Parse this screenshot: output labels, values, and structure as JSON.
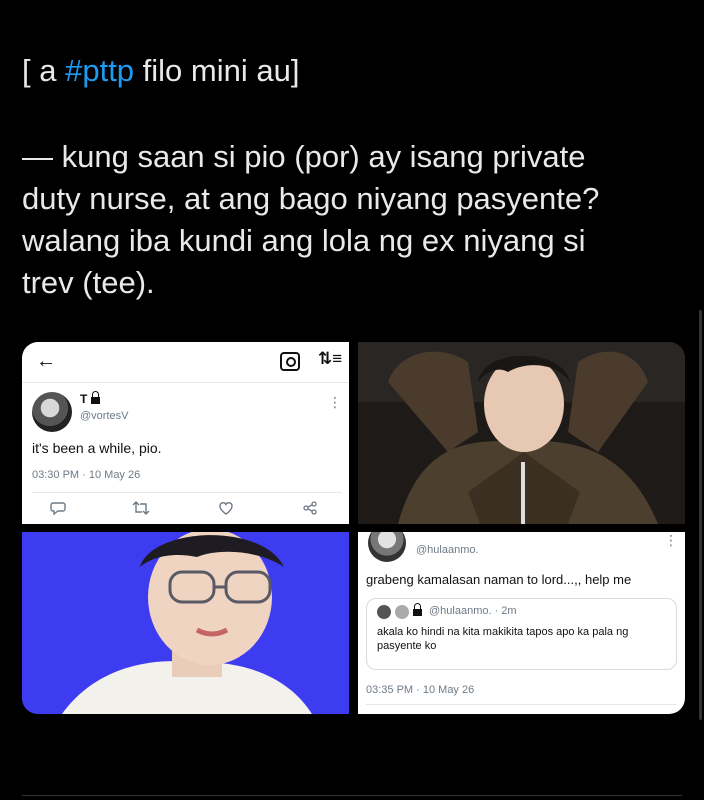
{
  "tweet": {
    "line_open": "[ a ",
    "hashtag": "#pttp",
    "line_close": " filo mini au]",
    "body_lines": [
      "— kung saan si pio (por) ay isang private",
      "duty nurse, at ang bago niyang pasyente?",
      "walang iba kundi ang lola ng ex niyang si",
      "trev (tee)."
    ]
  },
  "screenshot_1": {
    "back_icon": "arrow-left-icon",
    "camera_icon": "camera-icon",
    "sort_icon": "sort-icon",
    "name": "T",
    "handle": "@vortesV",
    "text": "it's been a while, pio.",
    "timestamp": "03:30 PM · 10 May 26",
    "actions": [
      "reply-icon",
      "retweet-icon",
      "like-icon",
      "share-icon"
    ]
  },
  "screenshot_2": {
    "handle": "@hulaanmo.",
    "text": "grabeng kamalasan naman to lord...,, help me",
    "quote_handle": "@hulaanmo. · 2m",
    "quote_text": "akala ko hindi na kita makikita tapos apo ka pala ng pasyente ko",
    "timestamp": "03:35 PM · 10 May 26"
  },
  "colors": {
    "background": "#000000",
    "text": "#e7e9ea",
    "accent": "#1d9bf0",
    "photo_bg_blue": "#3e3cf0"
  }
}
